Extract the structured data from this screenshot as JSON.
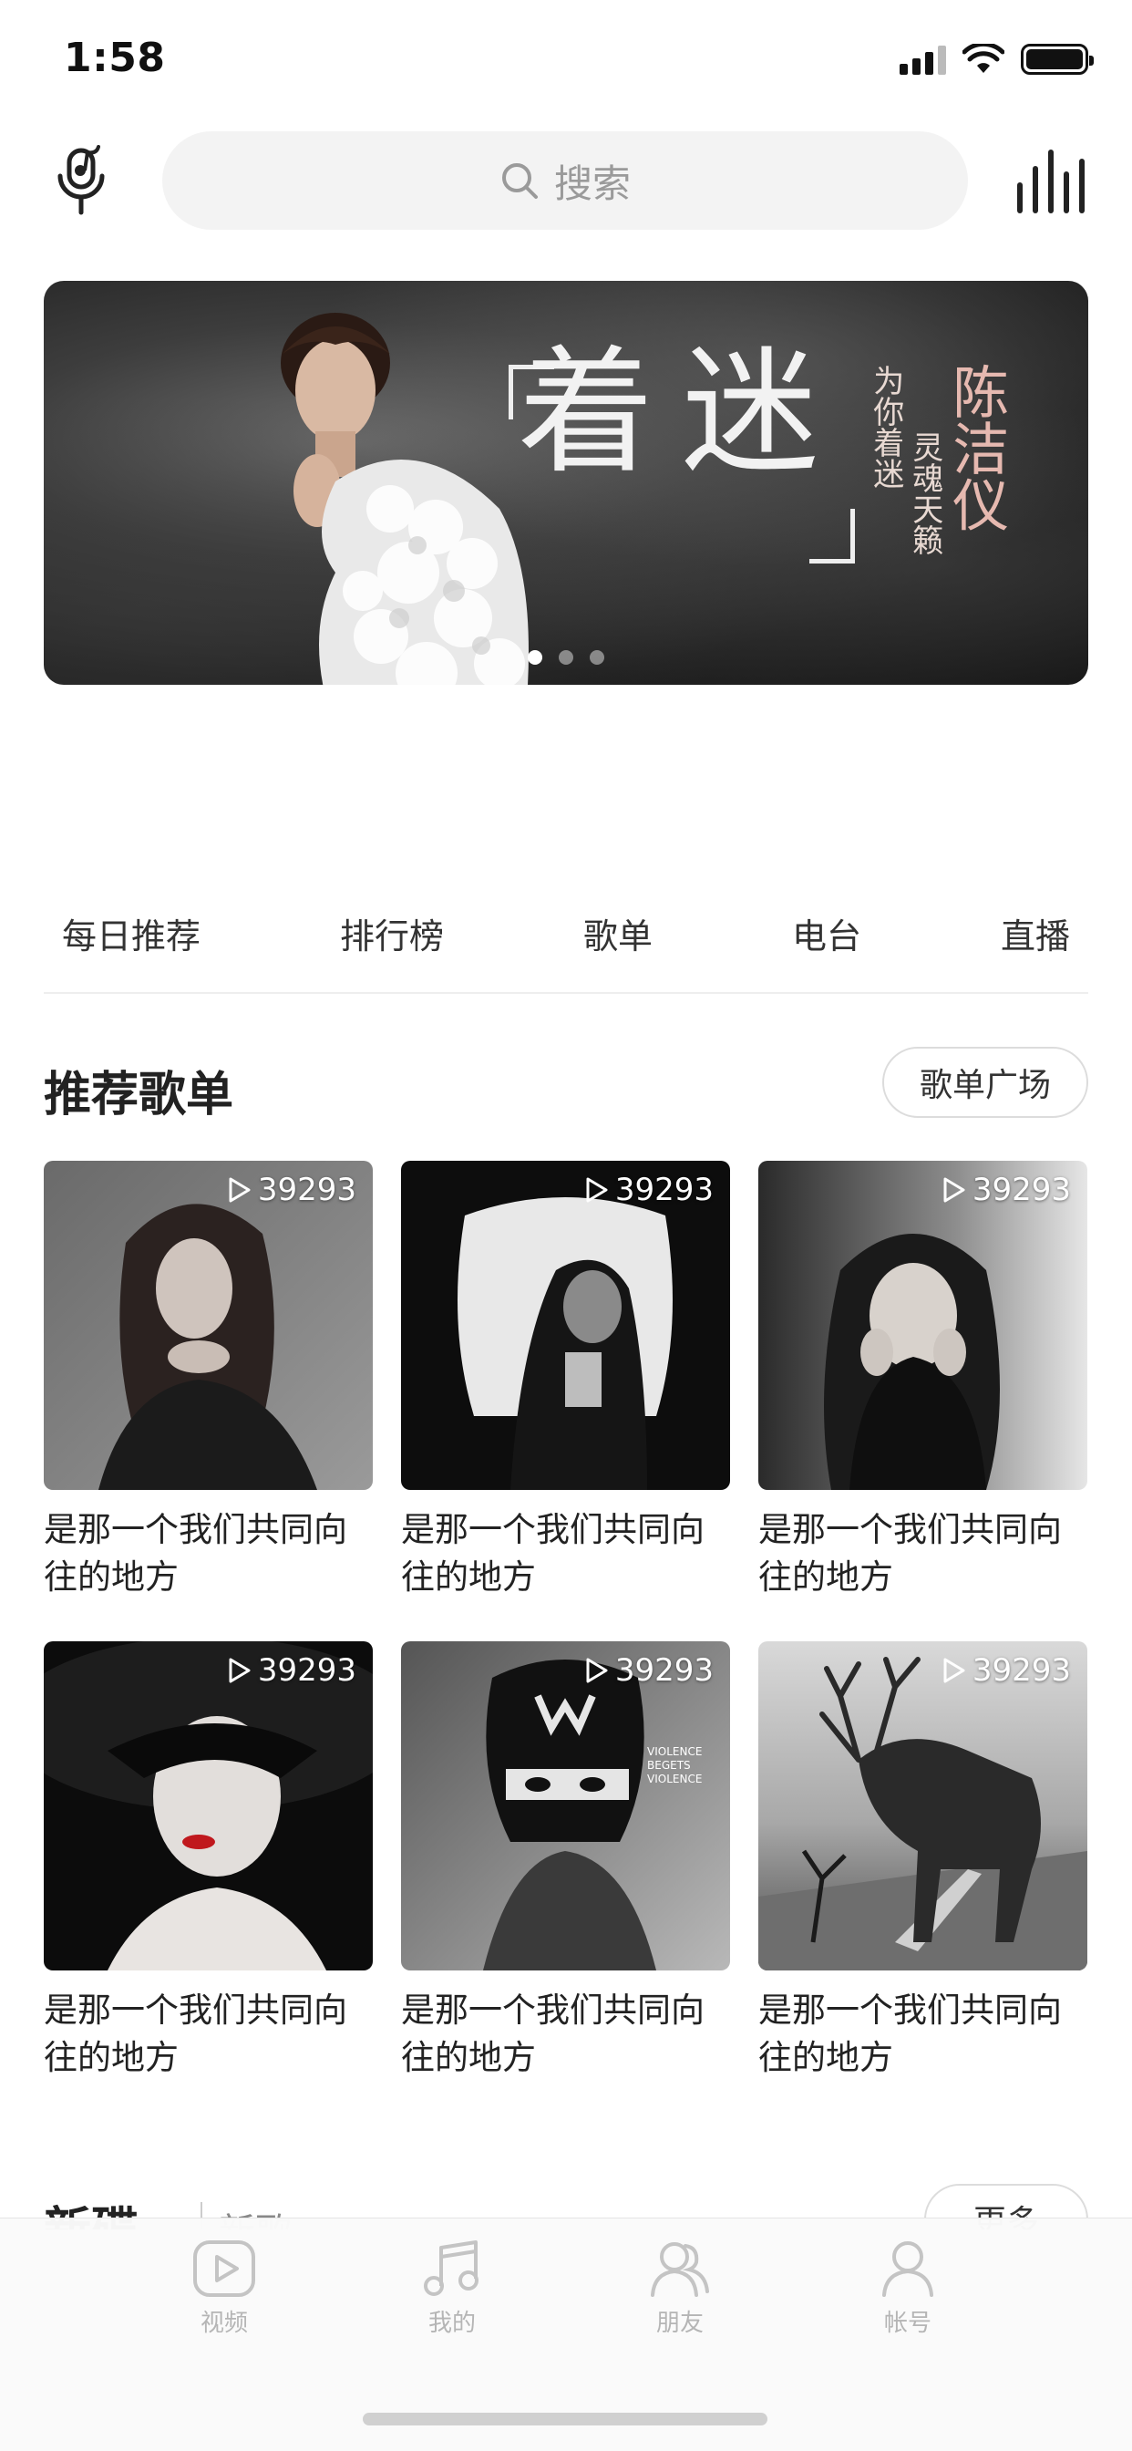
{
  "status_bar": {
    "time": "1:58"
  },
  "header": {
    "search_placeholder": "搜索"
  },
  "nav": {
    "items": [
      {
        "label": "每日推荐"
      },
      {
        "label": "排行榜"
      },
      {
        "label": "歌单"
      },
      {
        "label": "电台"
      },
      {
        "label": "直播"
      }
    ]
  },
  "banner": {
    "title": "着迷",
    "tagline_1": "为你着迷",
    "tagline_2": "灵魂天籁",
    "artist": "陈洁仪",
    "slides": 3,
    "active_slide": 1
  },
  "recommended": {
    "title": "推荐歌单",
    "plaza_button": "歌单广场",
    "playlists": [
      {
        "plays": "39293",
        "title": "是那一个我们共同向往的地方"
      },
      {
        "plays": "39293",
        "title": "是那一个我们共同向往的地方"
      },
      {
        "plays": "39293",
        "title": "是那一个我们共同向往的地方"
      },
      {
        "plays": "39293",
        "title": "是那一个我们共同向往的地方"
      },
      {
        "plays": "39293",
        "title": "是那一个我们共同向往的地方"
      },
      {
        "plays": "39293",
        "title": "是那一个我们共同向往的地方"
      }
    ]
  },
  "next_section": {
    "title": "新碟",
    "subtitle": "新歌",
    "more_button": "更多"
  },
  "tabbar": {
    "tabs": [
      {
        "label": "视频",
        "icon": "video-icon"
      },
      {
        "label": "我的",
        "icon": "music-note-icon"
      },
      {
        "label": "朋友",
        "icon": "friends-icon"
      },
      {
        "label": "帐号",
        "icon": "account-icon"
      }
    ]
  }
}
